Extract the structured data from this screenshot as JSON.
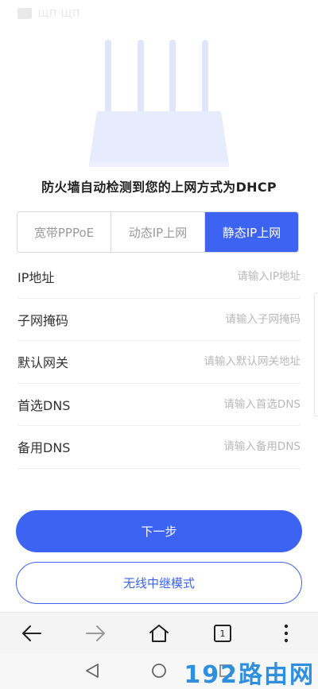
{
  "status": {
    "title": "ЩΠ ЩΠ",
    "right_text": ""
  },
  "detect_message": "防火墙自动检测到您的上网方式为DHCP",
  "connection_tabs": [
    {
      "label": "宽带PPPoE",
      "active": false
    },
    {
      "label": "动态IP上网",
      "active": false
    },
    {
      "label": "静态IP上网",
      "active": true
    }
  ],
  "form": {
    "ip": {
      "label": "IP地址",
      "placeholder": "请输入IP地址",
      "value": ""
    },
    "mask": {
      "label": "子网掩码",
      "placeholder": "请输入子网掩码",
      "value": ""
    },
    "gateway": {
      "label": "默认网关",
      "placeholder": "请输入默认网关地址",
      "value": ""
    },
    "dns1": {
      "label": "首选DNS",
      "placeholder": "请输入首选DNS",
      "value": ""
    },
    "dns2": {
      "label": "备用DNS",
      "placeholder": "请输入备用DNS",
      "value": ""
    }
  },
  "buttons": {
    "next": "下一步",
    "repeater": "无线中继模式"
  },
  "browser_bar": {
    "tab_count": "1",
    "icons": [
      "back-icon",
      "forward-icon",
      "home-icon",
      "tabs-icon",
      "more-icon"
    ]
  },
  "system_nav": {
    "icons": [
      "triangle-back-icon",
      "circle-home-icon",
      "square-recents-icon"
    ]
  },
  "watermark": "192路由网",
  "colors": {
    "accent": "#3d63f2",
    "watermark": "#2f8fdc",
    "router_illustration": "#dfe5fb"
  }
}
